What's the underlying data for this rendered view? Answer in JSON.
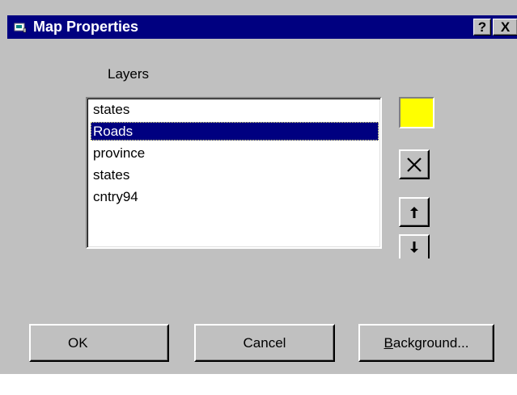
{
  "window": {
    "title": "Map Properties",
    "help_label": "?",
    "close_label": "X"
  },
  "layers": {
    "label": "Layers",
    "items": [
      {
        "label": "states",
        "selected": false
      },
      {
        "label": "Roads",
        "selected": true
      },
      {
        "label": "province",
        "selected": false
      },
      {
        "label": "states",
        "selected": false
      },
      {
        "label": "cntry94",
        "selected": false
      }
    ]
  },
  "tools": {
    "layer_color": "#ffff00",
    "delete_icon": "x-delete-icon",
    "move_up_icon": "arrow-up-icon",
    "move_down_icon": "arrow-down-icon"
  },
  "buttons": {
    "ok_label": "OK",
    "cancel_label": "Cancel",
    "background_accel": "B",
    "background_rest": "ackground..."
  }
}
